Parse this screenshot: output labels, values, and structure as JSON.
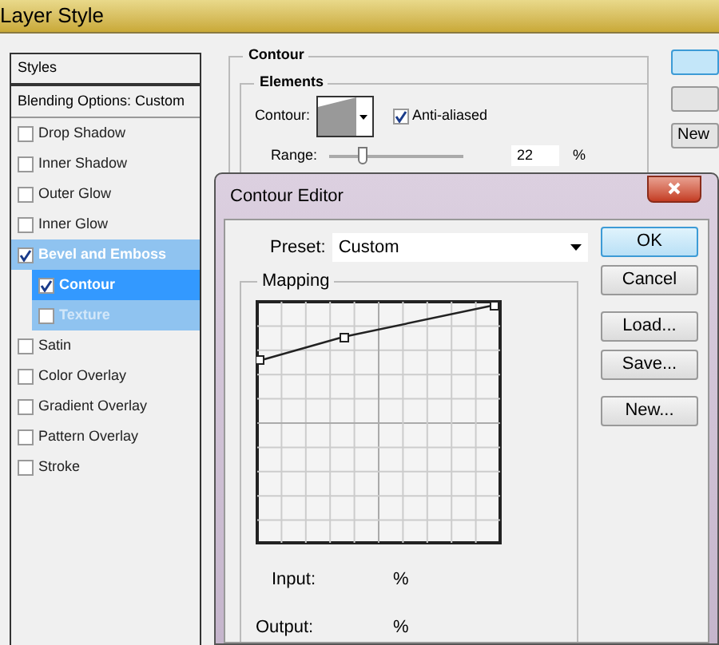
{
  "window": {
    "title": "Layer Style"
  },
  "styles_panel": {
    "header": "Styles",
    "items": [
      {
        "label": "Blending Options: Custom",
        "kind": "plain"
      },
      {
        "label": "Drop Shadow",
        "kind": "check",
        "checked": false,
        "selected": false
      },
      {
        "label": "Inner Shadow",
        "kind": "check",
        "checked": false,
        "selected": false
      },
      {
        "label": "Outer Glow",
        "kind": "check",
        "checked": false,
        "selected": false
      },
      {
        "label": "Inner Glow",
        "kind": "check",
        "checked": false,
        "selected": false
      },
      {
        "label": "Bevel and Emboss",
        "kind": "check",
        "checked": true,
        "selected": false,
        "expanded": true,
        "children": [
          {
            "label": "Contour",
            "checked": true,
            "selected": true
          },
          {
            "label": "Texture",
            "checked": false,
            "selected": false
          }
        ]
      },
      {
        "label": "Satin",
        "kind": "check",
        "checked": false,
        "selected": false
      },
      {
        "label": "Color Overlay",
        "kind": "check",
        "checked": false,
        "selected": false
      },
      {
        "label": "Gradient Overlay",
        "kind": "check",
        "checked": false,
        "selected": false
      },
      {
        "label": "Pattern Overlay",
        "kind": "check",
        "checked": false,
        "selected": false
      },
      {
        "label": "Stroke",
        "kind": "check",
        "checked": false,
        "selected": false
      }
    ]
  },
  "contour_section": {
    "title": "Contour",
    "elements_title": "Elements",
    "contour_label": "Contour:",
    "anti_aliased": {
      "label": "Anti-aliased",
      "checked": true
    },
    "range": {
      "label": "Range:",
      "level": 0.25,
      "value": "22",
      "unit": "%"
    }
  },
  "side_buttons": [
    {
      "kind": "primary"
    },
    {
      "kind": "plain"
    },
    {
      "kind": "plain",
      "label": "New"
    }
  ],
  "contour_editor": {
    "title": "Contour Editor",
    "preset": {
      "label": "Preset:",
      "value": "Custom"
    },
    "mapping": {
      "title": "Mapping",
      "input_label": "Input:",
      "input_unit": "%",
      "output_label": "Output:",
      "output_unit": "%"
    },
    "button_groups": [
      [
        {
          "label": "OK",
          "default": true
        },
        {
          "label": "Cancel",
          "default": false
        }
      ],
      [
        {
          "label": "Load...",
          "default": false
        },
        {
          "label": "Save...",
          "default": false
        }
      ],
      [
        {
          "label": "New...",
          "default": false
        }
      ]
    ]
  }
}
